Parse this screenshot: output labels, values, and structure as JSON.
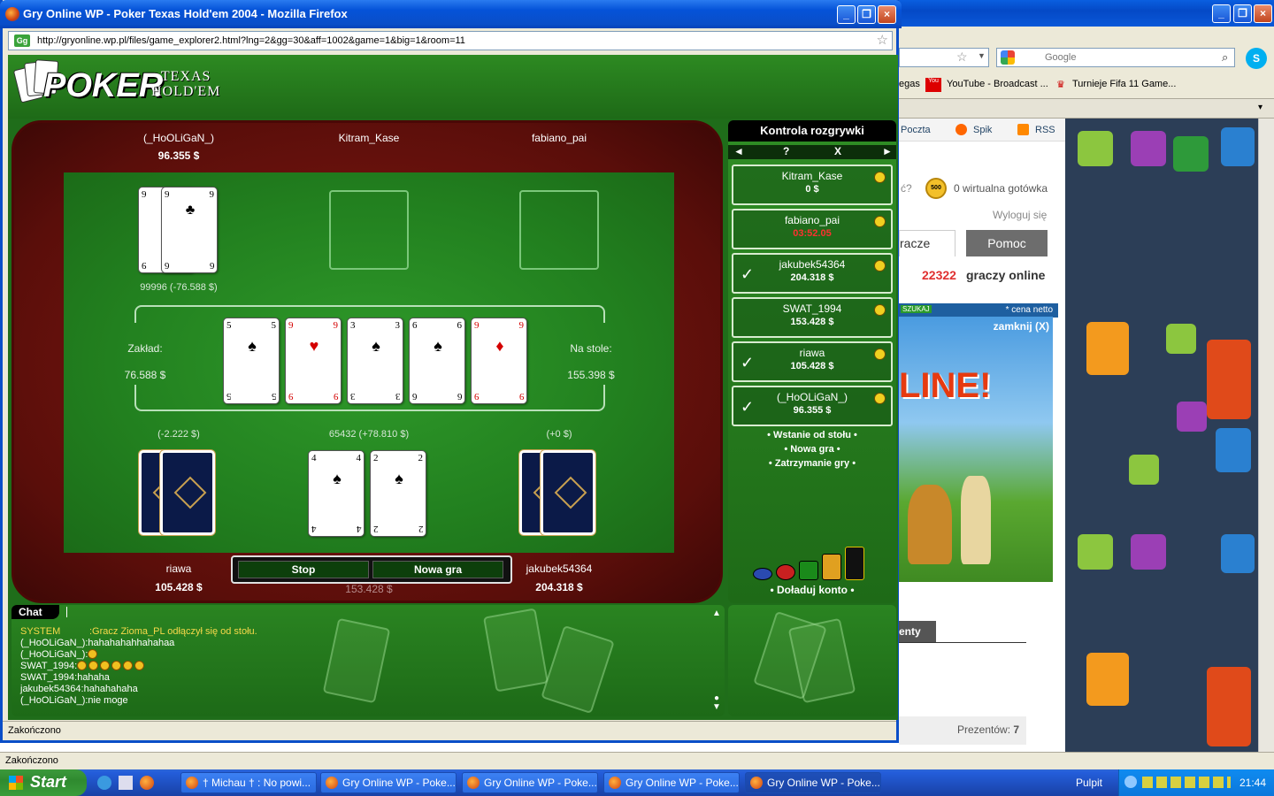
{
  "popup": {
    "title": "Gry Online WP - Poker Texas Hold'em 2004 - Mozilla Firefox",
    "url": "http://gryonline.wp.pl/files/game_explorer2.html?lng=2&gg=30&aff=1002&game=1&big=1&room=11",
    "status": "Zakończono"
  },
  "game": {
    "logo": "POKER",
    "subtitle_line1": "TEXAS",
    "subtitle_line2": "HOLD'EM",
    "top_players": [
      {
        "name": "(_HoOLiGaN_)",
        "money": "96.355 $"
      },
      {
        "name": "Kitram_Kase",
        "money": ""
      },
      {
        "name": "fabiano_pai",
        "money": ""
      }
    ],
    "bottom_players": [
      {
        "name": "riawa",
        "money": "105.428 $"
      },
      {
        "name": "jakubek54364",
        "money": "204.318 $"
      }
    ],
    "hand_note_top": "99996 (-76.588 $)",
    "note_left": "(-2.222 $)",
    "note_center": "65432 (+78.810 $)",
    "note_right": "(+0 $)",
    "bet_label": "Zakład:",
    "bet_value": "76.588 $",
    "pot_label": "Na stole:",
    "pot_value": "155.398 $",
    "hidden_money": "153.428 $",
    "community_cards": [
      {
        "rank": "5",
        "suit": "♠",
        "color": "black"
      },
      {
        "rank": "9",
        "suit": "♥",
        "color": "red"
      },
      {
        "rank": "3",
        "suit": "♠",
        "color": "black"
      },
      {
        "rank": "6",
        "suit": "♠",
        "color": "black"
      },
      {
        "rank": "9",
        "suit": "♦",
        "color": "red"
      }
    ],
    "hooligan_cards": [
      {
        "rank": "9",
        "suit": "♠"
      },
      {
        "rank": "6",
        "suit": "♣"
      }
    ],
    "player_cards": [
      {
        "rank": "4",
        "suit": "♠"
      },
      {
        "rank": "2",
        "suit": "♠"
      }
    ],
    "buttons": {
      "stop": "Stop",
      "new_game": "Nowa gra"
    }
  },
  "control": {
    "title": "Kontrola rozgrywki",
    "nav": {
      "prev": "◄",
      "help": "?",
      "close": "X",
      "next": "►"
    },
    "players": [
      {
        "name": "Kitram_Kase",
        "value": "0 $",
        "check": "",
        "timer": false
      },
      {
        "name": "fabiano_pai",
        "value": "03:52.05",
        "check": "",
        "timer": true
      },
      {
        "name": "jakubek54364",
        "value": "204.318 $",
        "check": "✓",
        "timer": false
      },
      {
        "name": "SWAT_1994",
        "value": "153.428 $",
        "check": "",
        "timer": false
      },
      {
        "name": "riawa",
        "value": "105.428 $",
        "check": "✓",
        "timer": false
      },
      {
        "name": "(_HoOLiGaN_)",
        "value": "96.355 $",
        "check": "✓",
        "timer": false
      }
    ],
    "links": [
      "• Wstanie od stołu •",
      "• Nowa gra •",
      "• Zatrzymanie gry •"
    ],
    "reload": "• Doładuj konto •"
  },
  "chat": {
    "tab": "Chat",
    "lines": [
      {
        "who": "SYSTEM",
        "text": ":Gracz Zioma_PL odłączył się od stołu.",
        "system": true,
        "emoticons": 0
      },
      {
        "who": "(_HoOLiGaN_)",
        "text": ":hahahahahhahahaa",
        "system": false,
        "emoticons": 0
      },
      {
        "who": "(_HoOLiGaN_)",
        "text": ":",
        "system": false,
        "emoticons": 1
      },
      {
        "who": "SWAT_1994",
        "text": ":",
        "system": false,
        "emoticons": 6
      },
      {
        "who": "SWAT_1994",
        "text": ":hahaha",
        "system": false,
        "emoticons": 0
      },
      {
        "who": "jakubek54364",
        "text": ":hahahahaha",
        "system": false,
        "emoticons": 0
      },
      {
        "who": "(_HoOLiGaN_)",
        "text": ":nie moge",
        "system": false,
        "emoticons": 0
      }
    ]
  },
  "background_window": {
    "search_placeholder": "Google",
    "bookmarks": [
      "egas",
      "YouTube - Broadcast ...",
      "Turnieje Fifa 11 Game..."
    ],
    "nav_links": [
      "Poczta",
      "Spik",
      "RSS"
    ],
    "gold": "0 wirtualna gotówka",
    "coin": "500",
    "logout": "Wyloguj się",
    "tab1": "racze",
    "tab2": "Pomoc",
    "online_count": "22322",
    "online_text": "graczy online",
    "ad_close": "zamknij (X)",
    "ad_text": "LINE!",
    "price_note": "* cena netto",
    "search_small": "SZUKAJ",
    "question": "ć?",
    "sec_tab": "enty",
    "gifts_label": "Prezentów:",
    "gifts_value": "7",
    "status": "Zakończono"
  },
  "taskbar": {
    "start": "Start",
    "buttons": [
      "† Michau † : No powi...",
      "Gry Online WP - Poke...",
      "Gry Online WP - Poke...",
      "Gry Online WP - Poke...",
      "Gry Online WP - Poke..."
    ],
    "desktop": "Pulpit",
    "clock": "21:44"
  }
}
